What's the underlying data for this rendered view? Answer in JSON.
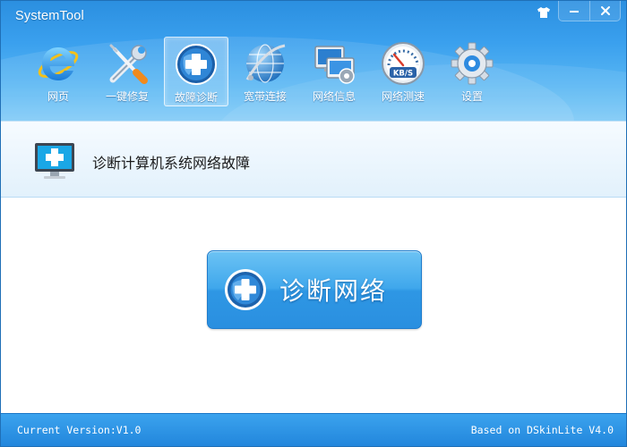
{
  "window": {
    "title": "SystemTool"
  },
  "toolbar": {
    "items": [
      {
        "id": "web",
        "label": "网页",
        "icon": "ie-browser-icon"
      },
      {
        "id": "repair",
        "label": "一键修复",
        "icon": "wrench-screwdriver-icon"
      },
      {
        "id": "diagnose",
        "label": "故障诊断",
        "icon": "medical-globe-icon",
        "active": true
      },
      {
        "id": "broadband",
        "label": "宽带连接",
        "icon": "network-globe-icon"
      },
      {
        "id": "netinfo",
        "label": "网络信息",
        "icon": "network-computers-icon"
      },
      {
        "id": "speed",
        "label": "网络测速",
        "icon": "speedometer-icon",
        "speedometer_text": "KB/S"
      },
      {
        "id": "settings",
        "label": "设置",
        "icon": "gear-icon"
      }
    ]
  },
  "controls": {
    "skin": "shirt-icon",
    "minimize": "minimize-icon",
    "close": "close-icon"
  },
  "section": {
    "title": "诊断计算机系统网络故障",
    "icon": "monitor-plus-icon"
  },
  "main": {
    "diagnose_button": "诊断网络",
    "diagnose_icon": "medical-globe-icon"
  },
  "status": {
    "left": "Current Version:V1.0",
    "right": "Based on DSkinLite V4.0"
  },
  "colors": {
    "header": "#3aa0ee",
    "status_bar": "#2a8fe0",
    "accent": "#2e97e4"
  }
}
